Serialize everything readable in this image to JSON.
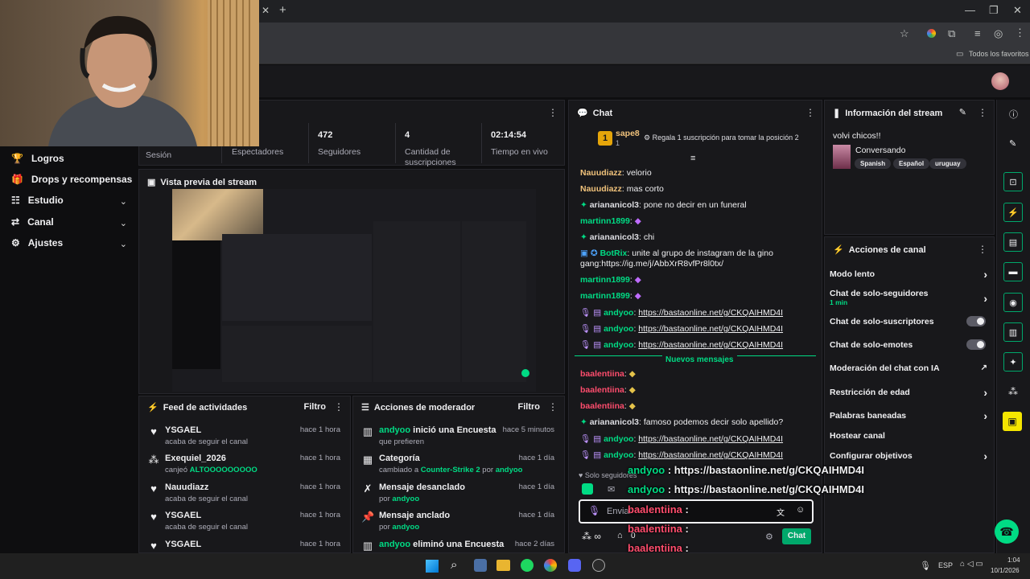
{
  "browser": {
    "new_tab": "+",
    "bookmarks_label": "Todos los favoritos"
  },
  "sidebar": {
    "items": [
      {
        "label": "Logros",
        "icon": "trophy-icon"
      },
      {
        "label": "Drops y recompensas",
        "icon": "gift-icon"
      },
      {
        "label": "Estudio",
        "icon": "studio-icon"
      },
      {
        "label": "Canal",
        "icon": "channel-icon"
      },
      {
        "label": "Ajustes",
        "icon": "gear-icon"
      }
    ]
  },
  "stats": {
    "session_label": "Sesión",
    "viewers_label": "Espectadores",
    "followers_value": "472",
    "followers_label": "Seguidores",
    "subs_value": "4",
    "subs_label": "Cantidad de suscripciones",
    "live_value": "02:14:54",
    "live_label": "Tiempo en vivo"
  },
  "preview": {
    "title": "Vista previa del stream"
  },
  "activity_feed": {
    "title": "Feed de actividades",
    "filter": "Filtro",
    "rows": [
      {
        "name": "YSGAEL",
        "sub": "acaba de seguir el canal",
        "time": "hace 1 hora",
        "icon": "heart-icon"
      },
      {
        "name": "Exequiel_2026",
        "sub": "canjeó",
        "highlight": "ALTOOOOOOOOO",
        "time": "hace 1 hora",
        "icon": "points-icon"
      },
      {
        "name": "Nauudiazz",
        "sub": "acaba de seguir el canal",
        "time": "hace 1 hora",
        "icon": "heart-icon"
      },
      {
        "name": "YSGAEL",
        "sub": "acaba de seguir el canal",
        "time": "hace 1 hora",
        "icon": "heart-icon"
      },
      {
        "name": "YSGAEL",
        "sub": "",
        "time": "hace 1 hora",
        "icon": "heart-icon"
      }
    ]
  },
  "mod_actions": {
    "title": "Acciones de moderador",
    "filter": "Filtro",
    "rows": [
      {
        "user": "andyoo",
        "action": " inició una Encuesta",
        "sub": "que prefieren",
        "time": "hace 5 minutos",
        "icon": "poll-icon"
      },
      {
        "action": "Categoría",
        "sub_pre": "cambiado a ",
        "sub_hl": "Counter-Strike 2",
        "sub_mid": " por ",
        "sub_user": "andyoo",
        "time": "hace 1 día",
        "icon": "category-icon"
      },
      {
        "action": "Mensaje desanclado",
        "sub_pre": "por ",
        "sub_user": "andyoo",
        "time": "hace 1 día",
        "icon": "unpin-icon"
      },
      {
        "action": "Mensaje anclado",
        "sub_pre": "por ",
        "sub_user": "andyoo",
        "time": "hace 1 día",
        "icon": "pin-icon"
      },
      {
        "user": "andyoo",
        "action": " eliminó una Encuesta",
        "time": "hace 2 días",
        "icon": "poll-icon"
      }
    ]
  },
  "chat": {
    "title": "Chat",
    "top_user": "sape8",
    "top_rank": "1",
    "top_count": "1",
    "gift_prompt": "Regala 1 suscripción para tomar la posición 2",
    "new_messages": "Nuevos mensajes",
    "followers_only": "Solo seguidores",
    "input_placeholder": "Enviar",
    "chat_button": "Chat",
    "points": "0",
    "messages": [
      {
        "user": "Nauudiazz",
        "text": ": velorio",
        "color": "#f0c27b"
      },
      {
        "user": "Nauudiazz",
        "text": ": mas corto",
        "color": "#f0c27b"
      },
      {
        "user": "ariananicol3",
        "text": ": pone no decir en un funeral",
        "color": "#dedee3",
        "badge": "star"
      },
      {
        "user": "martinn1899",
        "text": ":",
        "color": "#00db84",
        "emote": true
      },
      {
        "user": "ariananicol3",
        "text": ": chi",
        "color": "#dedee3",
        "badge": "star"
      },
      {
        "user": "BotRix",
        "text": ": unite al grupo de instagram de la gino",
        "color": "#00db84",
        "badge": "bot"
      },
      {
        "user": "",
        "text": "gang:https://ig.me/j/AbbXrR8vfPr8l0tx/",
        "color": "#dedee3"
      },
      {
        "user": "martinn1899",
        "text": ":",
        "color": "#00db84",
        "emote": true
      },
      {
        "user": "martinn1899",
        "text": ":",
        "color": "#00db84",
        "emote": true
      },
      {
        "user": "andyoo",
        "text": ": ",
        "link": "https://bastaonline.net/g/CKQAIHMD4I",
        "color": "#00db84",
        "badge": "mod"
      },
      {
        "user": "andyoo",
        "text": ": ",
        "link": "https://bastaonline.net/g/CKQAIHMD4I",
        "color": "#00db84",
        "badge": "mod"
      },
      {
        "user": "andyoo",
        "text": ": ",
        "link": "https://bastaonline.net/g/CKQAIHMD4I",
        "color": "#00db84",
        "badge": "mod"
      },
      {
        "user": "baalentiina",
        "text": ":",
        "color": "#ff4d6d",
        "emote": true
      },
      {
        "user": "baalentiina",
        "text": ":",
        "color": "#ff4d6d",
        "emote": true
      },
      {
        "user": "baalentiina",
        "text": ":",
        "color": "#ff4d6d",
        "emote": true
      },
      {
        "user": "ariananicol3",
        "text": ": famoso podemos decir solo apellido?",
        "color": "#dedee3",
        "badge": "star"
      },
      {
        "user": "andyoo",
        "text": ": ",
        "link": "https://bastaonline.net/g/CKQAIHMD4I",
        "color": "#00db84",
        "badge": "mod"
      },
      {
        "user": "andyoo",
        "text": ": ",
        "link": "https://bastaonline.net/g/CKQAIHMD4I",
        "color": "#00db84",
        "badge": "mod"
      }
    ]
  },
  "stream_info": {
    "title": "Información del stream",
    "stream_title": "volvi chicos!!",
    "category": "Conversando",
    "tags": [
      "Spanish",
      "Español",
      "uruguay"
    ]
  },
  "channel_actions": {
    "title": "Acciones de canal",
    "items": [
      {
        "label": "Modo lento",
        "control": "chevron"
      },
      {
        "label": "Chat de solo-seguidores",
        "sub": "1 min",
        "control": "chevron"
      },
      {
        "label": "Chat de solo-suscriptores",
        "control": "toggle"
      },
      {
        "label": "Chat de solo-emotes",
        "control": "toggle"
      },
      {
        "label": "Moderación del chat con IA",
        "control": "external"
      },
      {
        "label": "Restricción de edad",
        "control": "chevron"
      },
      {
        "label": "Palabras baneadas",
        "control": "chevron"
      },
      {
        "label": "Hostear canal",
        "control": "none"
      },
      {
        "label": "Configurar objetivos",
        "control": "chevron"
      }
    ]
  },
  "overlay": {
    "lines": [
      {
        "user": "andyoo",
        "text": " : https://bastaonline.net/g/CKQAIHMD4I",
        "color": "#00db84"
      },
      {
        "user": "andyoo",
        "text": " : https://bastaonline.net/g/CKQAIHMD4I",
        "color": "#00db84"
      },
      {
        "user": "baalentiina",
        "text": " :",
        "color": "#ff4d6d"
      },
      {
        "user": "baalentiina",
        "text": " :",
        "color": "#ff4d6d"
      },
      {
        "user": "baalentiina",
        "text": " :",
        "color": "#ff4d6d"
      },
      {
        "user": "ariananicol3",
        "text": " : famoso podemos decir solo apellido?",
        "color": "#dedee3"
      }
    ]
  },
  "taskbar": {
    "lang": "ESP",
    "time": "1:04",
    "date": "10/1/2026"
  },
  "colors": {
    "accent": "#00db84",
    "panel": "#18181b",
    "bg": "#0e0e10"
  }
}
